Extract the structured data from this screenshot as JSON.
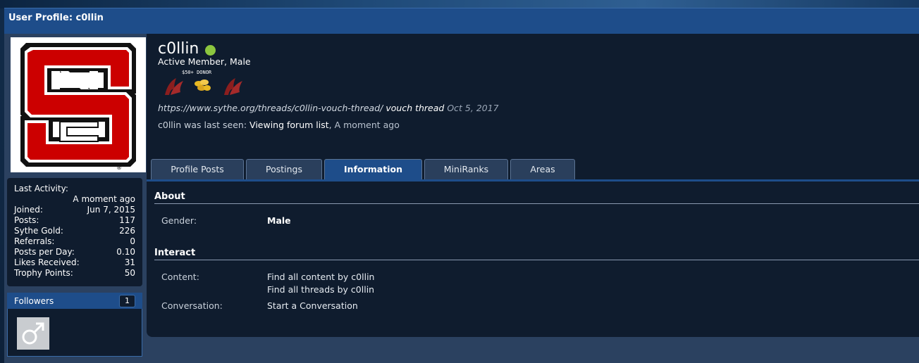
{
  "page": {
    "title": "User Profile: c0llin"
  },
  "profile": {
    "username": "c0llin",
    "user_title": "Active Member, Male",
    "donor_badge_text": "$50+ DONOR",
    "status": {
      "url": "https://www.sythe.org/threads/c0llin-vouch-thread/",
      "text": "vouch thread",
      "date": "Oct 5, 2017"
    },
    "last_seen": {
      "prefix": "c0llin was last seen:",
      "activity": "Viewing forum list",
      "separator": ",",
      "when": "A moment ago"
    },
    "online_color": "#8cc63f"
  },
  "stats": [
    {
      "label": "Last Activity:",
      "value": "A moment ago"
    },
    {
      "label": "Joined:",
      "value": "Jun 7, 2015"
    },
    {
      "label": "Posts:",
      "value": "117"
    },
    {
      "label": "Sythe Gold:",
      "value": "226"
    },
    {
      "label": "Referrals:",
      "value": "0"
    },
    {
      "label": "Posts per Day:",
      "value": "0.10"
    },
    {
      "label": "Likes Received:",
      "value": "31"
    },
    {
      "label": "Trophy Points:",
      "value": "50"
    }
  ],
  "followers": {
    "label": "Followers",
    "count": "1",
    "avatar_icon": "male-symbol-icon"
  },
  "tabs": [
    {
      "label": "Profile Posts",
      "active": false
    },
    {
      "label": "Postings",
      "active": false
    },
    {
      "label": "Information",
      "active": true
    },
    {
      "label": "MiniRanks",
      "active": false
    },
    {
      "label": "Areas",
      "active": false
    }
  ],
  "about": {
    "heading": "About",
    "gender_label": "Gender:",
    "gender_value": "Male"
  },
  "interact": {
    "heading": "Interact",
    "content_label": "Content:",
    "find_content": "Find all content by c0llin",
    "find_threads": "Find all threads by c0llin",
    "conversation_label": "Conversation:",
    "start_conversation": "Start a Conversation"
  },
  "colors": {
    "accent": "#1e4d8a",
    "panel": "#0f1c2e",
    "logo_red": "#cc0000"
  },
  "avatar_icon": "nc-state-logo"
}
